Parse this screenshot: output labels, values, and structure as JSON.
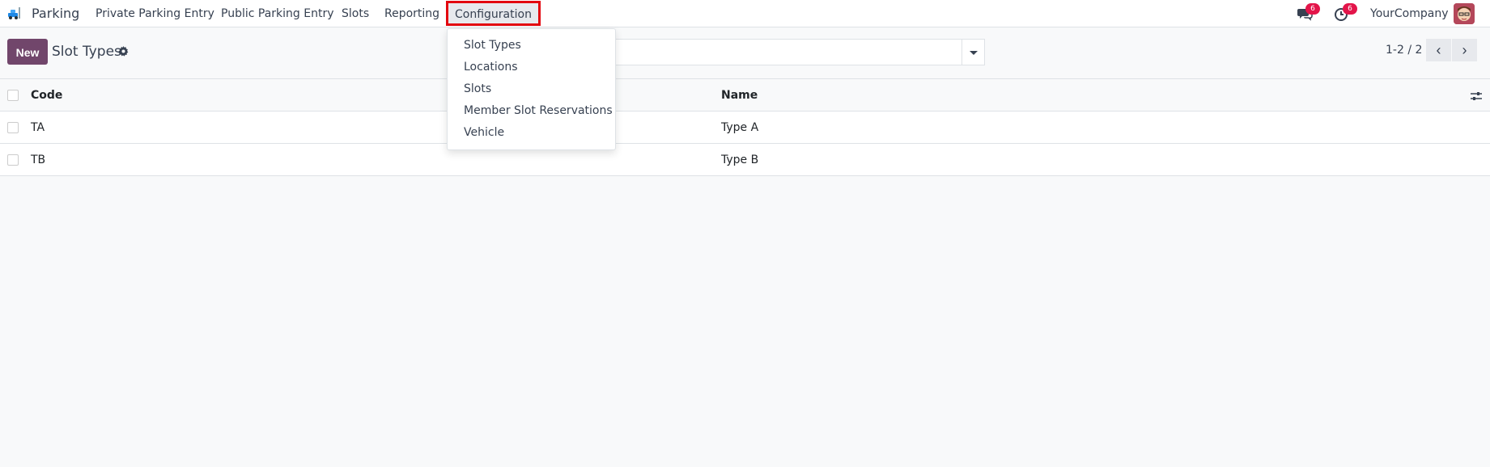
{
  "navbar": {
    "app_name": "Parking",
    "menu": [
      {
        "label": "Private Parking Entry"
      },
      {
        "label": "Public Parking Entry"
      },
      {
        "label": "Slots"
      },
      {
        "label": "Reporting"
      },
      {
        "label": "Configuration",
        "active": true
      }
    ],
    "messages_badge": "6",
    "activities_badge": "6",
    "company": "YourCompany"
  },
  "control_panel": {
    "new_label": "New",
    "title": "Slot Types",
    "pager": "1-2 / 2"
  },
  "table": {
    "columns": [
      "Code",
      "Name"
    ],
    "rows": [
      {
        "code": "TA",
        "name": "Type A"
      },
      {
        "code": "TB",
        "name": "Type B"
      }
    ]
  },
  "configuration_menu": {
    "items": [
      "Slot Types",
      "Locations",
      "Slots",
      "Member Slot Reservations",
      "Vehicle"
    ]
  },
  "colors": {
    "primary": "#71466b",
    "highlight_border": "#e3060f",
    "badge": "#e3154a"
  }
}
